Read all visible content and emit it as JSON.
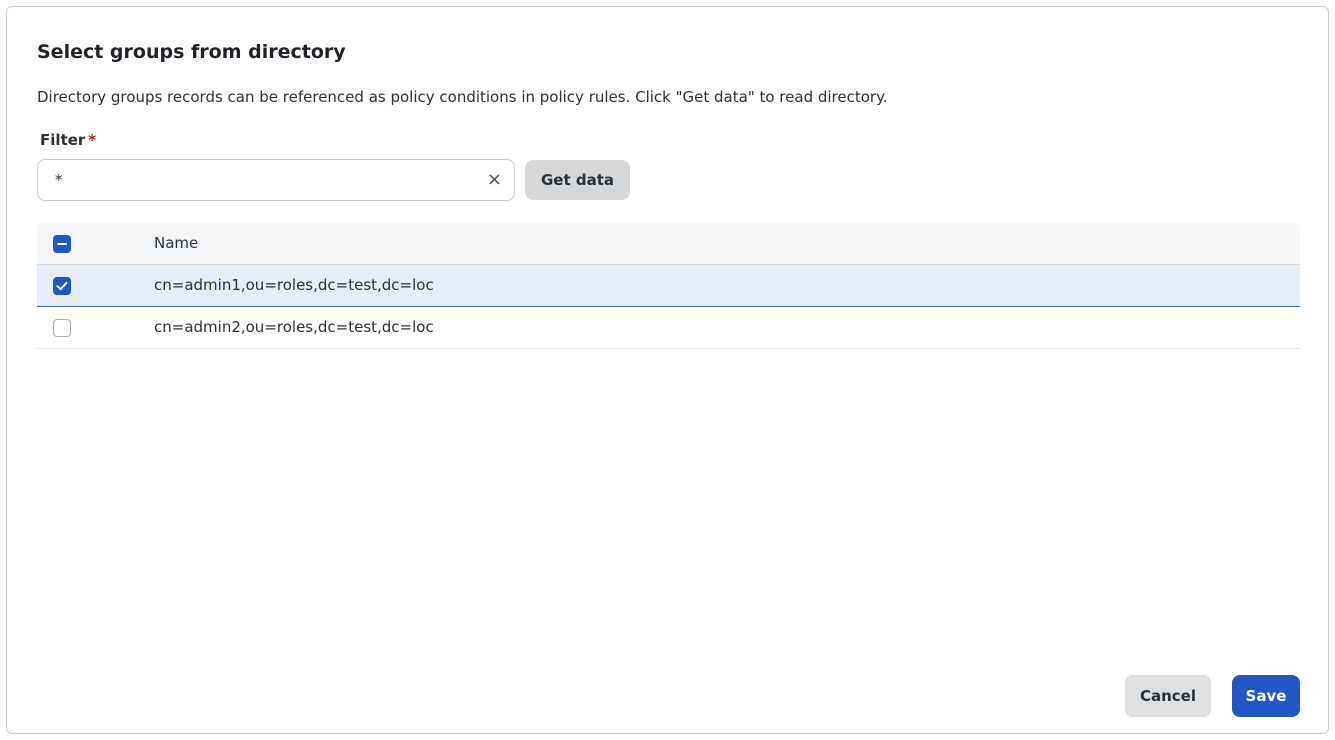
{
  "dialog": {
    "title": "Select groups from directory",
    "description": "Directory groups records can be referenced as policy conditions in policy rules. Click \"Get data\" to read directory."
  },
  "filter": {
    "label": "Filter",
    "required_marker": "*",
    "value": "*",
    "clear_glyph": "×",
    "clear_icon": "close-icon"
  },
  "get_data_label": "Get data",
  "table": {
    "header": {
      "name": "Name",
      "select_all_state": "indeterminate"
    },
    "rows": [
      {
        "name": "cn=admin1,ou=roles,dc=test,dc=loc",
        "checked": true
      },
      {
        "name": "cn=admin2,ou=roles,dc=test,dc=loc",
        "checked": false
      }
    ]
  },
  "footer": {
    "cancel_label": "Cancel",
    "save_label": "Save"
  },
  "colors": {
    "primary": "#2257c5",
    "selected_row": "#e6edf7",
    "required": "#b42318"
  }
}
